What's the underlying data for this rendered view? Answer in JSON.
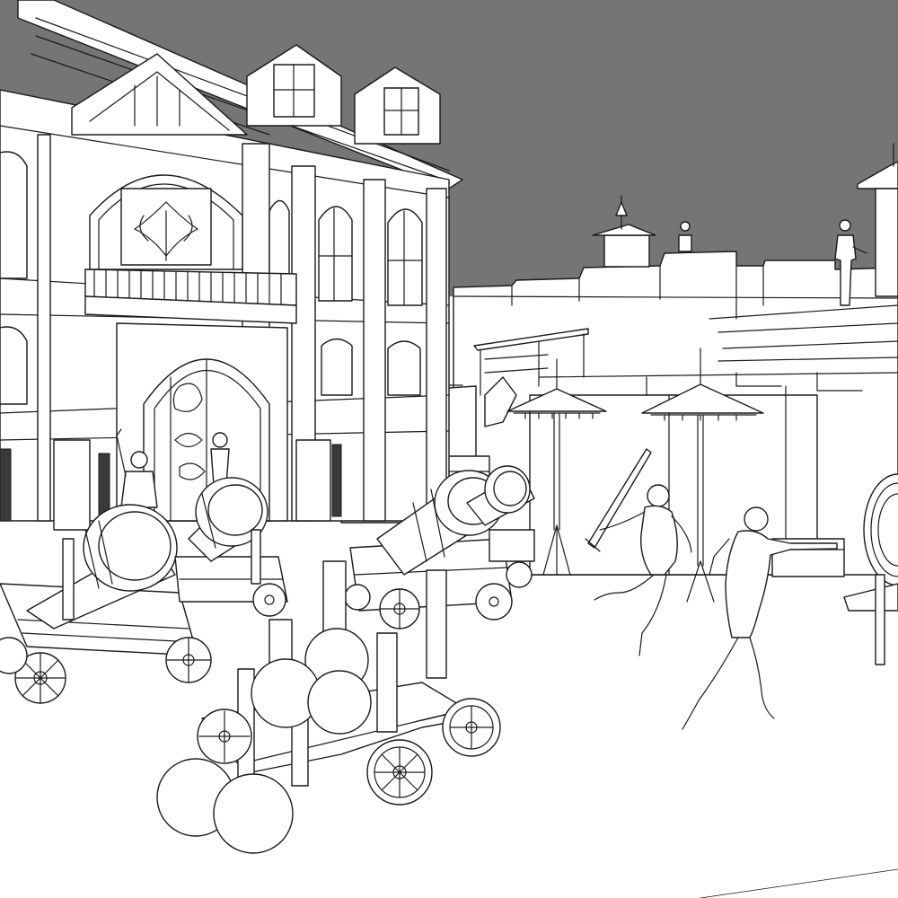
{
  "scene": {
    "style": "black-and-white line art",
    "sky_color": "#757575",
    "line_color": "#1a1a1a",
    "fill_color": "#ffffff",
    "elements": {
      "building": "ornate-manor",
      "walls": "castle-battlements",
      "cannons": 4,
      "cannonball_cart": 1,
      "loose_cannonballs": 2,
      "umbrellas": 2,
      "figures": [
        "swordsman",
        "archer",
        "wall-sentry",
        "balcony-figures"
      ],
      "target": "archery-target"
    }
  }
}
